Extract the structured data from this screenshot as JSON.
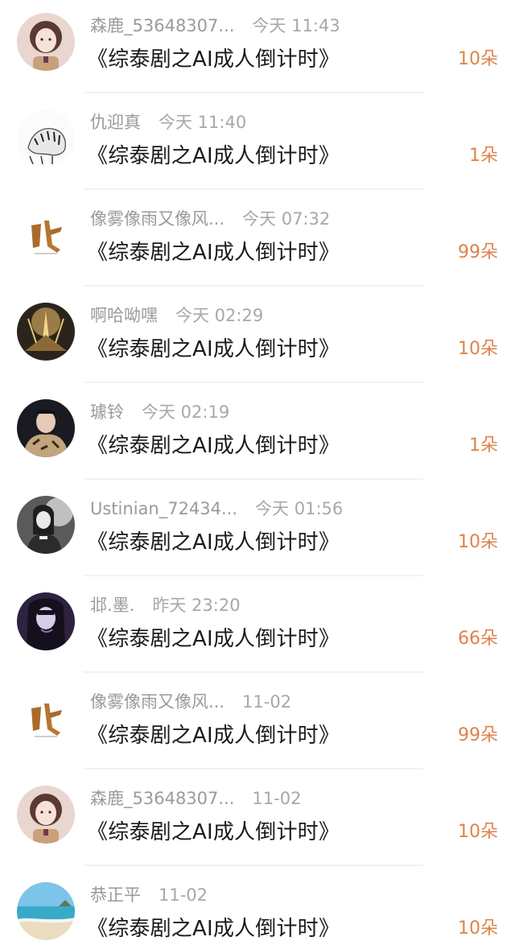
{
  "colors": {
    "username": "#9a9a9a",
    "title": "#1a1a1a",
    "count": "#e0824a",
    "divider": "#f2f2f2"
  },
  "items": [
    {
      "avatar": "anime-girl-avatar",
      "username": "森鹿_53648307...",
      "time": "今天 11:43",
      "title": "《综泰剧之AI成人倒计时》",
      "count": "10朵"
    },
    {
      "avatar": "tiger-sketch-avatar",
      "username": "仇迎真",
      "time": "今天 11:40",
      "title": "《综泰剧之AI成人倒计时》",
      "count": "1朵"
    },
    {
      "avatar": "zhan-calligraphy-avatar",
      "username": "像雾像雨又像风...",
      "time": "今天 07:32",
      "title": "《综泰剧之AI成人倒计时》",
      "count": "99朵"
    },
    {
      "avatar": "golden-light-avatar",
      "username": "啊哈呦嘿",
      "time": "今天 02:29",
      "title": "《综泰剧之AI成人倒计时》",
      "count": "10朵"
    },
    {
      "avatar": "man-fur-coat-avatar",
      "username": "璩铃",
      "time": "今天 02:19",
      "title": "《综泰剧之AI成人倒计时》",
      "count": "1朵"
    },
    {
      "avatar": "monochrome-girl-avatar",
      "username": "Ustinian_72434...",
      "time": "今天 01:56",
      "title": "《综泰剧之AI成人倒计时》",
      "count": "10朵"
    },
    {
      "avatar": "dark-hair-girl-avatar",
      "username": "邶.墨.",
      "time": "昨天 23:20",
      "title": "《综泰剧之AI成人倒计时》",
      "count": "66朵"
    },
    {
      "avatar": "zhan-calligraphy-avatar",
      "username": "像雾像雨又像风...",
      "time": "11-02",
      "title": "《综泰剧之AI成人倒计时》",
      "count": "99朵"
    },
    {
      "avatar": "anime-girl-avatar",
      "username": "森鹿_53648307...",
      "time": "11-02",
      "title": "《综泰剧之AI成人倒计时》",
      "count": "10朵"
    },
    {
      "avatar": "beach-avatar",
      "username": "恭正平",
      "time": "11-02",
      "title": "《综泰剧之AI成人倒计时》",
      "count": "10朵"
    }
  ]
}
